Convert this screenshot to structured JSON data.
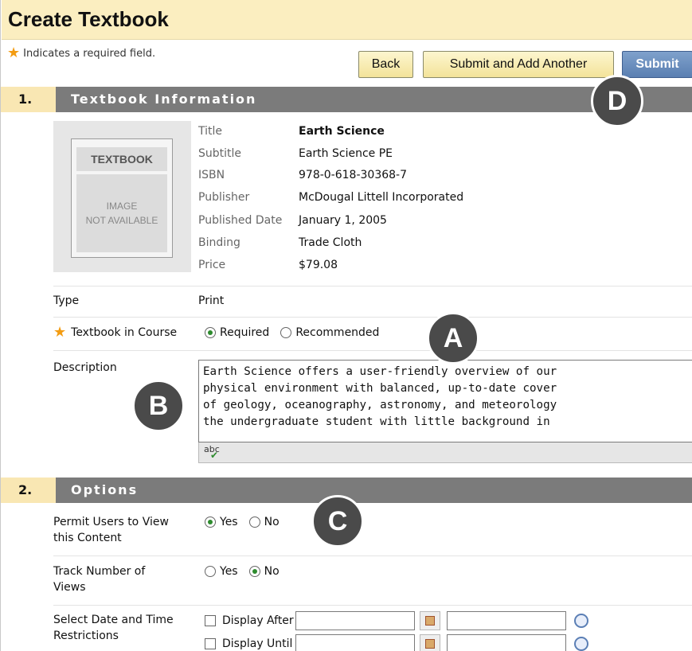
{
  "page": {
    "title": "Create Textbook",
    "required_note": "Indicates a required field."
  },
  "toolbar": {
    "back_label": "Back",
    "submit_add_label": "Submit and Add Another",
    "submit_label": "Submit"
  },
  "section1": {
    "number": "1.",
    "title": "Textbook Information"
  },
  "thumbnail": {
    "top_text": "TEXTBOOK",
    "line1": "IMAGE",
    "line2": "NOT AVAILABLE"
  },
  "book_info": [
    {
      "key": "Title",
      "value": "Earth Science"
    },
    {
      "key": "Subtitle",
      "value": "Earth Science PE"
    },
    {
      "key": "ISBN",
      "value": "978-0-618-30368-7"
    },
    {
      "key": "Publisher",
      "value": "McDougal Littell Incorporated"
    },
    {
      "key": "Published Date",
      "value": "January 1, 2005"
    },
    {
      "key": "Binding",
      "value": "Trade Cloth"
    },
    {
      "key": "Price",
      "value": "$79.08"
    }
  ],
  "type_row": {
    "label": "Type",
    "value": "Print"
  },
  "in_course": {
    "label": "Textbook in Course",
    "opt1": "Required",
    "opt2": "Recommended",
    "selected": "Required"
  },
  "description": {
    "label": "Description",
    "lines": [
      "Earth Science offers a user-friendly overview of our",
      "physical environment with balanced, up-to-date cover",
      "of geology, oceanography, astronomy, and meteorology",
      "the undergraduate student with little background in"
    ],
    "spell_label": "abc"
  },
  "section2": {
    "number": "2.",
    "title": "Options"
  },
  "permit": {
    "label_line1": "Permit Users to View",
    "label_line2": "this Content",
    "yes": "Yes",
    "no": "No",
    "selected": "Yes"
  },
  "track": {
    "label_line1": "Track Number of",
    "label_line2": "Views",
    "yes": "Yes",
    "no": "No",
    "selected": "No"
  },
  "restrictions": {
    "label_line1": "Select Date and Time",
    "label_line2": "Restrictions",
    "display_after": "Display After",
    "display_until": "Display Until"
  },
  "callouts": {
    "a": "A",
    "b": "B",
    "c": "C",
    "d": "D"
  }
}
